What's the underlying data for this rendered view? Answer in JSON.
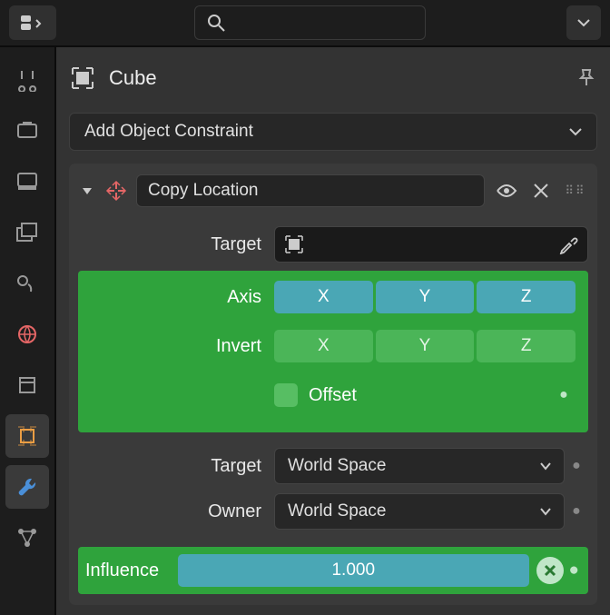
{
  "header": {
    "object_name": "Cube"
  },
  "add_constraint_label": "Add Object Constraint",
  "constraint": {
    "name": "Copy Location",
    "target_label": "Target",
    "target_value": "",
    "axis_label": "Axis",
    "axis": {
      "x": "X",
      "y": "Y",
      "z": "Z"
    },
    "invert_label": "Invert",
    "invert": {
      "x": "X",
      "y": "Y",
      "z": "Z"
    },
    "offset_label": "Offset",
    "target_space_label": "Target",
    "target_space_value": "World Space",
    "owner_label": "Owner",
    "owner_space_value": "World Space",
    "influence_label": "Influence",
    "influence_value": "1.000"
  }
}
